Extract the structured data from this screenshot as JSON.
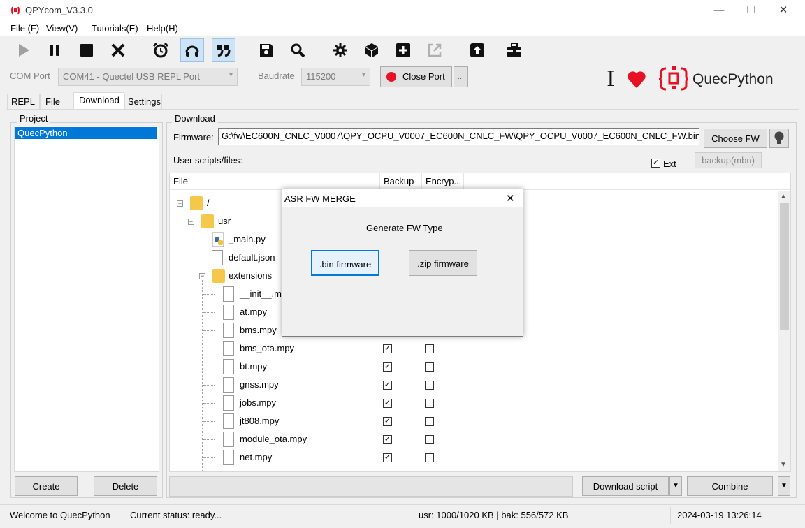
{
  "window": {
    "title": "QPYcom_V3.3.0",
    "minimize": "—",
    "maximize": "☐",
    "close": "✕"
  },
  "menu": [
    "File (F)",
    "View(V)",
    "Tutorials(E)",
    "Help(H)"
  ],
  "toolbar": {
    "icons": [
      "play-icon",
      "pause-icon",
      "stop-icon",
      "clear-icon",
      "alarm-clock-icon",
      "headset-icon",
      "quote-icon",
      "save-icon",
      "search-icon",
      "settings-icon",
      "cube-icon",
      "plus-icon",
      "external-link-icon",
      "upload-icon",
      "toolbox-icon"
    ]
  },
  "port": {
    "com_label": "COM Port",
    "com_value": "COM41 - Quectel USB REPL Port",
    "baud_label": "Baudrate",
    "baud_value": "115200",
    "close_port": "Close Port",
    "more": "...",
    "status_color": "#e81123"
  },
  "brand": {
    "name": "QuecPython",
    "cursor": "I",
    "heart_color": "#e81123",
    "logo_color": "#e81123"
  },
  "tabs": [
    "REPL",
    "File",
    "Download",
    "Settings"
  ],
  "project": {
    "title": "Project",
    "items": [
      "QuecPython"
    ],
    "create": "Create",
    "delete": "Delete"
  },
  "download": {
    "title": "Download",
    "firmware_label": "Firmware:",
    "firmware_path": "G:\\fw\\EC600N_CNLC_V0007\\QPY_OCPU_V0007_EC600N_CNLC_FW\\QPY_OCPU_V0007_EC600N_CNLC_FW.bin",
    "choose_fw": "Choose FW",
    "user_scripts_label": "User scripts/files:",
    "ext_label": "Ext",
    "backup_mbn": "backup(mbn)",
    "columns": [
      "File",
      "Backup",
      "Encryp..."
    ],
    "tree": [
      {
        "name": "/",
        "type": "folder",
        "level": 0
      },
      {
        "name": "usr",
        "type": "folder",
        "level": 1
      },
      {
        "name": "_main.py",
        "type": "python",
        "level": 2
      },
      {
        "name": "default.json",
        "type": "file",
        "level": 2
      },
      {
        "name": "extensions",
        "type": "folder",
        "level": 2
      },
      {
        "name": "__init__.mpy",
        "type": "file",
        "level": 3
      },
      {
        "name": "at.mpy",
        "type": "file",
        "level": 3
      },
      {
        "name": "bms.mpy",
        "type": "file",
        "level": 3
      },
      {
        "name": "bms_ota.mpy",
        "type": "file",
        "level": 3,
        "backup": true,
        "encrypt": false
      },
      {
        "name": "bt.mpy",
        "type": "file",
        "level": 3,
        "backup": true,
        "encrypt": false
      },
      {
        "name": "gnss.mpy",
        "type": "file",
        "level": 3,
        "backup": true,
        "encrypt": false
      },
      {
        "name": "jobs.mpy",
        "type": "file",
        "level": 3,
        "backup": true,
        "encrypt": false
      },
      {
        "name": "jt808.mpy",
        "type": "file",
        "level": 3,
        "backup": true,
        "encrypt": false
      },
      {
        "name": "module_ota.mpy",
        "type": "file",
        "level": 3,
        "backup": true,
        "encrypt": false
      },
      {
        "name": "net.mpy",
        "type": "file",
        "level": 3,
        "backup": true,
        "encrypt": false
      }
    ],
    "download_script": "Download script",
    "combine": "Combine"
  },
  "dialog": {
    "title": "ASR FW MERGE",
    "message": "Generate FW Type",
    "bin_button": ".bin firmware",
    "zip_button": ".zip firmware",
    "close": "✕"
  },
  "status": {
    "welcome": "Welcome to QuecPython",
    "current": "Current status: ready...",
    "usage": "usr: 1000/1020 KB | bak: 556/572 KB",
    "datetime": "2024-03-19 13:26:14"
  }
}
